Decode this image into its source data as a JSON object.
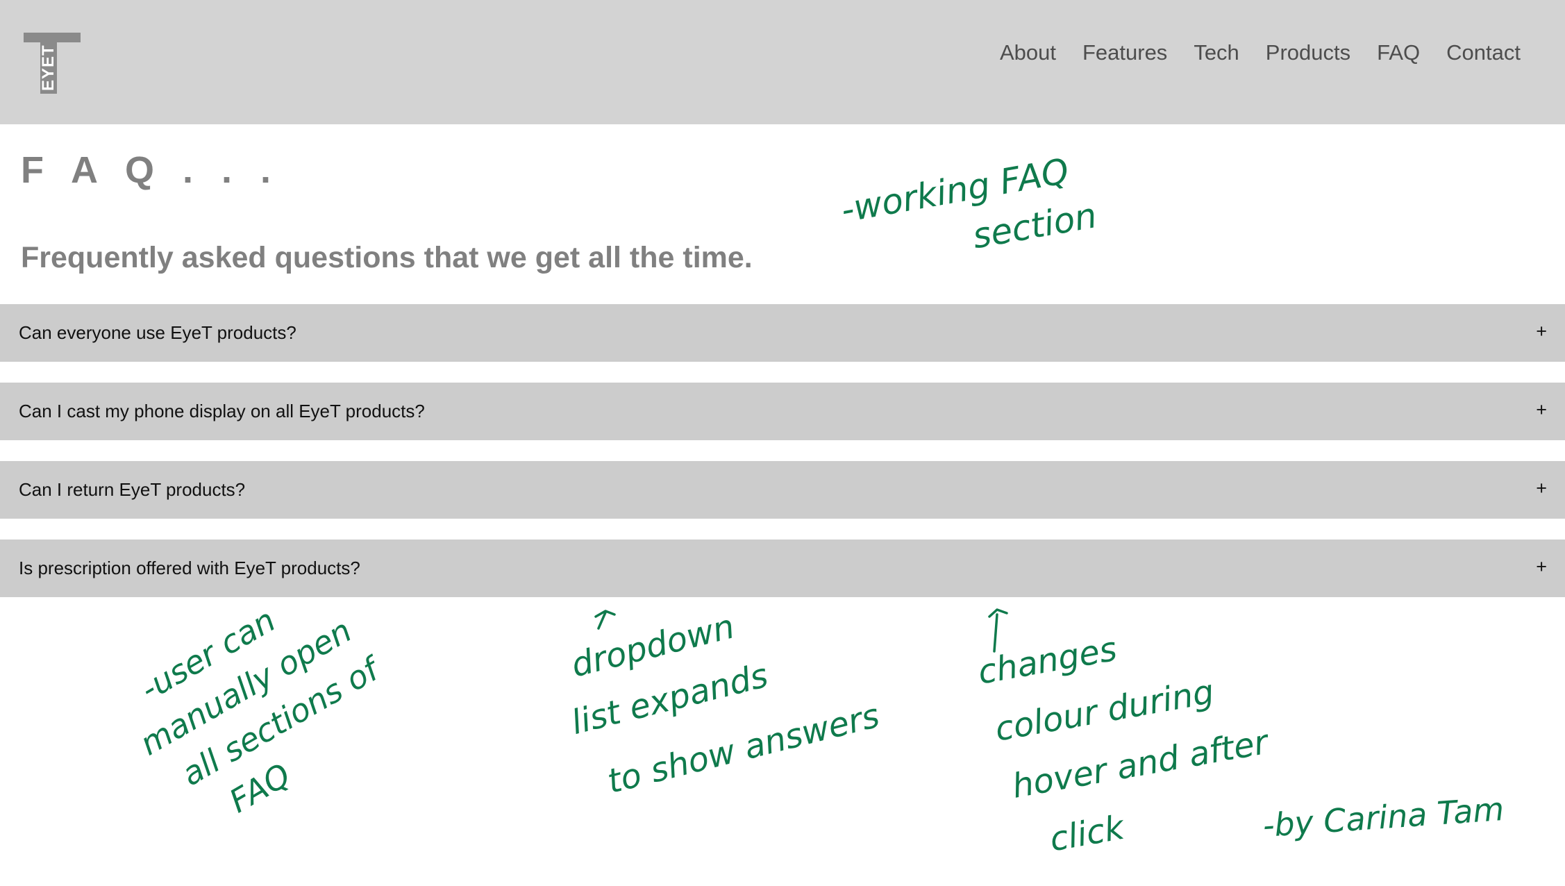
{
  "header": {
    "logo_text": "EYET",
    "nav": [
      "About",
      "Features",
      "Tech",
      "Products",
      "FAQ",
      "Contact"
    ]
  },
  "main": {
    "title": "F A Q . . .",
    "subtitle": "Frequently asked questions that we get all the time.",
    "faq_items": [
      {
        "question": "Can everyone use EyeT products?",
        "toggle": "+"
      },
      {
        "question": "Can I cast my phone display on all EyeT products?",
        "toggle": "+"
      },
      {
        "question": "Can I return EyeT products?",
        "toggle": "+"
      },
      {
        "question": "Is prescription offered with EyeT products?",
        "toggle": "+"
      }
    ]
  },
  "annotations": {
    "working_faq": [
      "-working FAQ",
      "section"
    ],
    "user_can": [
      "-user can",
      "manually open",
      "all sections of",
      "FAQ"
    ],
    "dropdown": [
      "dropdown",
      "list expands",
      "to show answers"
    ],
    "changes": [
      "changes",
      "colour during",
      "hover and after",
      "click"
    ],
    "author": "-by Carina Tam"
  },
  "colors": {
    "header_bg": "#d3d3d3",
    "faq_item_bg": "#cccccc",
    "heading_text": "#808080",
    "nav_text": "#4d4d4d",
    "annotation_ink": "#0f7a4c"
  }
}
